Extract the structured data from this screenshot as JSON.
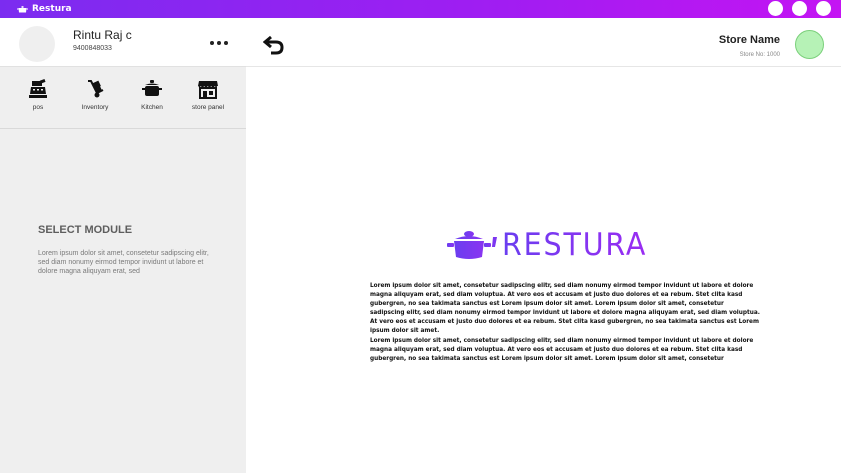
{
  "app": {
    "title": "Restura"
  },
  "window_controls": [
    "minimize",
    "maximize",
    "close"
  ],
  "user": {
    "name": "Rintu Raj c",
    "phone": "9400848033"
  },
  "modules": [
    {
      "label": "pos",
      "icon": "cash-register-icon"
    },
    {
      "label": "Inventory",
      "icon": "hand-truck-icon"
    },
    {
      "label": "Kitchen",
      "icon": "cooking-pot-icon"
    },
    {
      "label": "store panel",
      "icon": "storefront-icon"
    }
  ],
  "select_module": {
    "title": "SELECT MODULE",
    "description": "Lorem ipsum dolor sit amet, consetetur sadipscing elitr, sed diam nonumy eirmod tempor invidunt ut labore et dolore magna aliquyam erat, sed"
  },
  "store": {
    "name": "Store Name",
    "number": "Store No: 1000"
  },
  "brand": {
    "logo_text": "RESTURA",
    "accent_start": "#6a3ef0",
    "accent_end": "#c414f3"
  },
  "paragraphs": [
    "Lorem ipsum dolor sit amet, consetetur sadipscing elitr, sed diam nonumy eirmod tempor invidunt ut labore et dolore magna aliquyam erat, sed diam voluptua. At vero eos et accusam et justo duo dolores et ea rebum. Stet clita kasd gubergren, no sea takimata sanctus est Lorem ipsum dolor sit amet. Lorem ipsum dolor sit amet, consetetur sadipscing elitr, sed diam nonumy eirmod tempor invidunt ut labore et dolore magna aliquyam erat, sed diam voluptua. At vero eos et accusam et justo duo dolores et ea rebum. Stet clita kasd gubergren, no sea takimata sanctus est Lorem ipsum dolor sit amet.",
    "Lorem ipsum dolor sit amet, consetetur sadipscing elitr, sed diam nonumy eirmod tempor invidunt ut labore et dolore magna aliquyam erat, sed diam voluptua. At vero eos et accusam et justo duo dolores et ea rebum. Stet clita kasd gubergren, no sea takimata sanctus est Lorem ipsum dolor sit amet. Lorem ipsum dolor sit amet, consetetur"
  ]
}
